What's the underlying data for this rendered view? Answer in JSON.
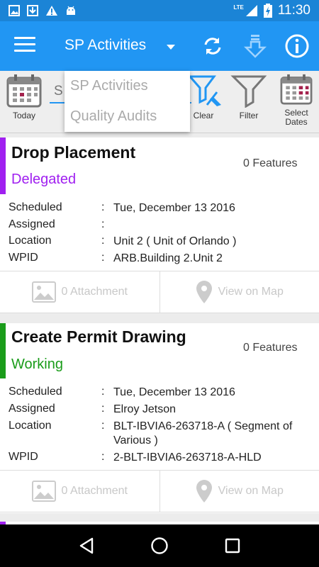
{
  "status_bar": {
    "time": "11:30",
    "network": "LTE"
  },
  "app_bar": {
    "title": "SP Activities"
  },
  "dropdown": {
    "options": [
      "SP Activities",
      "Quality Audits"
    ]
  },
  "toolbar": {
    "search_placeholder": "S",
    "today_label": "Today",
    "clear_label": "Clear",
    "filter_label": "Filter",
    "select_dates_label": "Select Dates"
  },
  "cards": [
    {
      "title": "Drop Placement",
      "features": "0 Features",
      "status": "Delegated",
      "status_color": "#a020f0",
      "fields": [
        {
          "label": "Scheduled",
          "colon": ":",
          "value": "Tue, December 13 2016"
        },
        {
          "label": "Assigned",
          "colon": ":",
          "value": ""
        },
        {
          "label": "Location",
          "colon": ":",
          "value": "Unit 2 ( Unit of Orlando )"
        },
        {
          "label": "WPID",
          "colon": ":",
          "value": "ARB.Building 2.Unit 2"
        }
      ],
      "attachment_label": "0 Attachment",
      "map_label": "View on Map"
    },
    {
      "title": "Create Permit Drawing",
      "features": "0 Features",
      "status": "Working",
      "status_color": "#1a9c1a",
      "fields": [
        {
          "label": "Scheduled",
          "colon": ":",
          "value": "Tue, December 13 2016"
        },
        {
          "label": "Assigned",
          "colon": ":",
          "value": "Elroy Jetson"
        },
        {
          "label": "Location",
          "colon": ":",
          "value": "BLT-IBVIA6-263718-A ( Segment of Various )"
        },
        {
          "label": "WPID",
          "colon": ":",
          "value": "2-BLT-IBVIA6-263718-A-HLD"
        }
      ],
      "attachment_label": "0 Attachment",
      "map_label": "View on Map"
    }
  ],
  "colors": {
    "primary": "#2196f3",
    "status_bar": "#1b84d6",
    "third_card_accent": "#a020f0"
  },
  "icons": [
    "menu-icon",
    "caret-down-icon",
    "refresh-icon",
    "download-icon",
    "info-icon",
    "calendar-icon",
    "funnel-broom-icon",
    "funnel-icon",
    "image-icon",
    "map-pin-icon",
    "back-icon",
    "home-icon",
    "recents-icon"
  ]
}
